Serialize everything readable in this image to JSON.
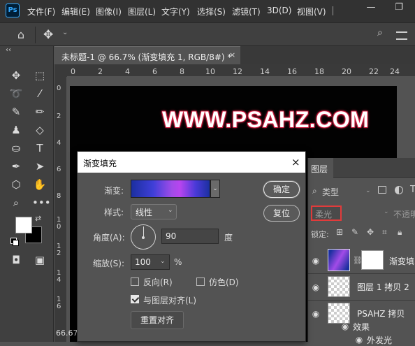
{
  "app": {
    "logo": "Ps"
  },
  "menu": [
    "文件(F)",
    "编辑(E)",
    "图像(I)",
    "图层(L)",
    "文字(Y)",
    "选择(S)",
    "滤镜(T)",
    "3D(D)",
    "视图(V)"
  ],
  "window_controls": {
    "minimize": "—",
    "restore": "❐"
  },
  "document": {
    "tab_title": "未标题-1 @ 66.7% (渐变填充 1, RGB/8#) *",
    "close": "×",
    "zoom": "66.67",
    "canvas_text": "WWW.PSAHZ.COM"
  },
  "rulers": {
    "top": [
      "0",
      "2",
      "4",
      "6",
      "8",
      "10",
      "12",
      "14",
      "16",
      "18",
      "20",
      "22",
      "24"
    ],
    "left": [
      "0",
      "2",
      "4",
      "6",
      "8",
      "1\n0",
      "1\n2",
      "1\n4",
      "1\n6"
    ]
  },
  "dialog": {
    "title": "渐变填充",
    "close": "×",
    "gradient_label": "渐变:",
    "style_label": "样式:",
    "style_value": "线性",
    "angle_label": "角度(A):",
    "angle_value": "90",
    "angle_unit": "度",
    "scale_label": "缩放(S):",
    "scale_value": "100",
    "scale_unit": "%",
    "reverse_label": "反向(R)",
    "reverse_checked": false,
    "dither_label": "仿色(D)",
    "dither_checked": false,
    "align_label": "与图层对齐(L)",
    "align_checked": true,
    "reset_align_label": "重置对齐",
    "ok_label": "确定",
    "cancel_label": "复位",
    "gradient_colors": [
      "#1b2fa0",
      "#3f3fd8",
      "#a24be8",
      "#b845ef",
      "#4a3ad8",
      "#1b2fa0"
    ]
  },
  "layers_panel": {
    "tab": "图层",
    "filter_kind": "类型",
    "blend_mode": "柔光",
    "opacity_label": "不透明",
    "lock_label": "锁定:",
    "layers": [
      {
        "name": "渐变填",
        "type": "gradient-fill"
      },
      {
        "name": "图层 1 拷贝 2",
        "type": "pixel"
      },
      {
        "name": "PSAHZ 拷贝",
        "type": "text"
      }
    ],
    "effects_label": "效果",
    "effect_item": "外发光"
  },
  "colors": {
    "accent_highlight": "#e23b3b",
    "foreground": "#ffffff",
    "background": "#000000",
    "text_stroke": "#c0183a"
  }
}
